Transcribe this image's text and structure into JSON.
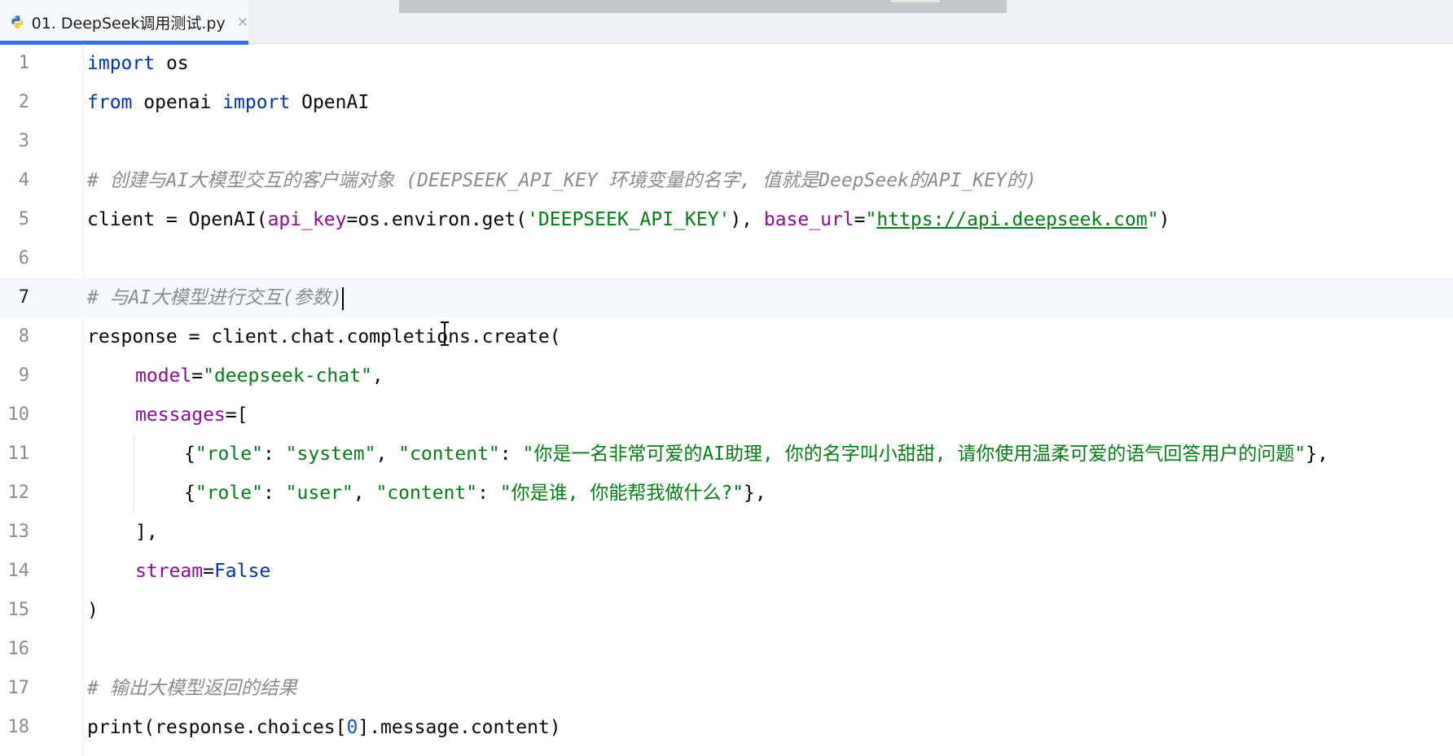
{
  "tab": {
    "label": "01. DeepSeek调用测试.py",
    "close": "×",
    "icon": "python-file-icon"
  },
  "colors": {
    "keyword": "#0033b3",
    "string": "#067d17",
    "comment": "#8c8c8c",
    "parameter": "#871094",
    "number": "#1750eb",
    "tab_underline": "#3574f0"
  },
  "editor": {
    "current_line": 7,
    "line_numbers": [
      "1",
      "2",
      "3",
      "4",
      "5",
      "6",
      "7",
      "8",
      "9",
      "10",
      "11",
      "12",
      "13",
      "14",
      "15",
      "16",
      "17",
      "18"
    ],
    "tokens": {
      "l1_import": "import",
      "l1_rest": " os",
      "l2_from": "from",
      "l2_mid": " openai ",
      "l2_import": "import",
      "l2_rest": " OpenAI",
      "l4_comment": "# 创建与AI大模型交互的客户端对象 (DEEPSEEK_API_KEY 环境变量的名字, 值就是DeepSeek的API_KEY的)",
      "l5_a": "client = OpenAI(",
      "l5_param1": "api_key",
      "l5_b": "=os.environ.get(",
      "l5_str1": "'DEEPSEEK_API_KEY'",
      "l5_c": "), ",
      "l5_param2": "base_url",
      "l5_d": "=",
      "l5_q1": "\"",
      "l5_url": "https://api.deepseek.com",
      "l5_q2": "\"",
      "l5_e": ")",
      "l7_comment": "# 与AI大模型进行交互(参数)",
      "l8": "response = client.chat.completions.create(",
      "l9_param": "model",
      "l9_eq": "=",
      "l9_str": "\"deepseek-chat\"",
      "l9_end": ",",
      "l10_param": "messages",
      "l10_rest": "=[",
      "l11_a": "{",
      "l11_k1": "\"role\"",
      "l11_c1": ": ",
      "l11_v1": "\"system\"",
      "l11_c2": ", ",
      "l11_k2": "\"content\"",
      "l11_c3": ": ",
      "l11_v2": "\"你是一名非常可爱的AI助理, 你的名字叫小甜甜, 请你使用温柔可爱的语气回答用户的问题\"",
      "l11_end": "},",
      "l12_a": "{",
      "l12_k1": "\"role\"",
      "l12_c1": ": ",
      "l12_v1": "\"user\"",
      "l12_c2": ", ",
      "l12_k2": "\"content\"",
      "l12_c3": ": ",
      "l12_v2": "\"你是谁, 你能帮我做什么?\"",
      "l12_end": "},",
      "l13": "],",
      "l14_param": "stream",
      "l14_eq": "=",
      "l14_val": "False",
      "l15": ")",
      "l17_comment": "# 输出大模型返回的结果",
      "l18_a": "print(response.choices[",
      "l18_num": "0",
      "l18_b": "].message.content)"
    }
  }
}
